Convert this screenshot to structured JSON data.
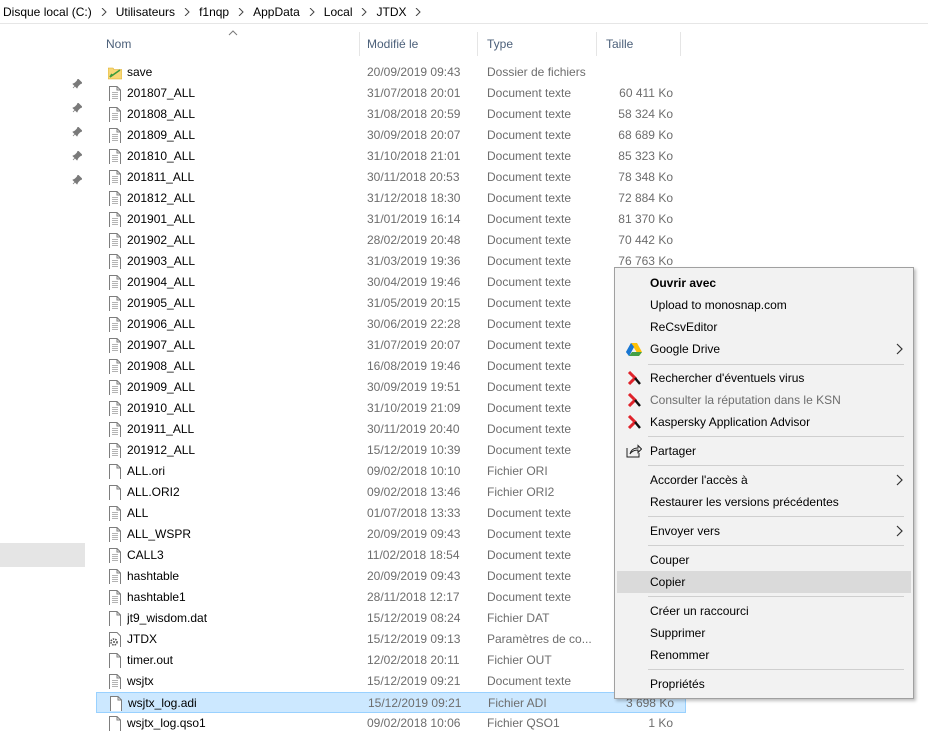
{
  "breadcrumb": [
    "Disque local (C:)",
    "Utilisateurs",
    "f1nqp",
    "AppData",
    "Local",
    "JTDX"
  ],
  "columns": {
    "name": "Nom",
    "modified": "Modifié le",
    "type": "Type",
    "size": "Taille"
  },
  "files": [
    {
      "name": "save",
      "date": "20/09/2019 09:43",
      "type": "Dossier de fichiers",
      "size": "",
      "icon": "folder-icon"
    },
    {
      "name": "201807_ALL",
      "date": "31/07/2018 20:01",
      "type": "Document texte",
      "size": "60 411 Ko",
      "icon": "text-file-icon"
    },
    {
      "name": "201808_ALL",
      "date": "31/08/2018 20:59",
      "type": "Document texte",
      "size": "58 324 Ko",
      "icon": "text-file-icon"
    },
    {
      "name": "201809_ALL",
      "date": "30/09/2018 20:07",
      "type": "Document texte",
      "size": "68 689 Ko",
      "icon": "text-file-icon"
    },
    {
      "name": "201810_ALL",
      "date": "31/10/2018 21:01",
      "type": "Document texte",
      "size": "85 323 Ko",
      "icon": "text-file-icon"
    },
    {
      "name": "201811_ALL",
      "date": "30/11/2018 20:53",
      "type": "Document texte",
      "size": "78 348 Ko",
      "icon": "text-file-icon"
    },
    {
      "name": "201812_ALL",
      "date": "31/12/2018 18:30",
      "type": "Document texte",
      "size": "72 884 Ko",
      "icon": "text-file-icon"
    },
    {
      "name": "201901_ALL",
      "date": "31/01/2019 16:14",
      "type": "Document texte",
      "size": "81 370 Ko",
      "icon": "text-file-icon"
    },
    {
      "name": "201902_ALL",
      "date": "28/02/2019 20:48",
      "type": "Document texte",
      "size": "70 442 Ko",
      "icon": "text-file-icon"
    },
    {
      "name": "201903_ALL",
      "date": "31/03/2019 19:36",
      "type": "Document texte",
      "size": "76 763 Ko",
      "icon": "text-file-icon"
    },
    {
      "name": "201904_ALL",
      "date": "30/04/2019 19:46",
      "type": "Document texte",
      "size": "",
      "icon": "text-file-icon"
    },
    {
      "name": "201905_ALL",
      "date": "31/05/2019 20:15",
      "type": "Document texte",
      "size": "",
      "icon": "text-file-icon"
    },
    {
      "name": "201906_ALL",
      "date": "30/06/2019 22:28",
      "type": "Document texte",
      "size": "",
      "icon": "text-file-icon"
    },
    {
      "name": "201907_ALL",
      "date": "31/07/2019 20:07",
      "type": "Document texte",
      "size": "",
      "icon": "text-file-icon"
    },
    {
      "name": "201908_ALL",
      "date": "16/08/2019 19:46",
      "type": "Document texte",
      "size": "",
      "icon": "text-file-icon"
    },
    {
      "name": "201909_ALL",
      "date": "30/09/2019 19:51",
      "type": "Document texte",
      "size": "",
      "icon": "text-file-icon"
    },
    {
      "name": "201910_ALL",
      "date": "31/10/2019 21:09",
      "type": "Document texte",
      "size": "",
      "icon": "text-file-icon"
    },
    {
      "name": "201911_ALL",
      "date": "30/11/2019 20:40",
      "type": "Document texte",
      "size": "",
      "icon": "text-file-icon"
    },
    {
      "name": "201912_ALL",
      "date": "15/12/2019 10:39",
      "type": "Document texte",
      "size": "",
      "icon": "text-file-icon"
    },
    {
      "name": "ALL.ori",
      "date": "09/02/2018 10:10",
      "type": "Fichier ORI",
      "size": "",
      "icon": "file-icon"
    },
    {
      "name": "ALL.ORI2",
      "date": "09/02/2018 13:46",
      "type": "Fichier ORI2",
      "size": "",
      "icon": "file-icon"
    },
    {
      "name": "ALL",
      "date": "01/07/2018 13:33",
      "type": "Document texte",
      "size": "",
      "icon": "text-file-icon"
    },
    {
      "name": "ALL_WSPR",
      "date": "20/09/2019 09:43",
      "type": "Document texte",
      "size": "",
      "icon": "text-file-icon"
    },
    {
      "name": "CALL3",
      "date": "11/02/2018 18:54",
      "type": "Document texte",
      "size": "",
      "icon": "text-file-icon"
    },
    {
      "name": "hashtable",
      "date": "20/09/2019 09:43",
      "type": "Document texte",
      "size": "",
      "icon": "text-file-icon"
    },
    {
      "name": "hashtable1",
      "date": "28/11/2018 12:17",
      "type": "Document texte",
      "size": "",
      "icon": "text-file-icon"
    },
    {
      "name": "jt9_wisdom.dat",
      "date": "15/12/2019 08:24",
      "type": "Fichier DAT",
      "size": "",
      "icon": "file-icon"
    },
    {
      "name": "JTDX",
      "date": "15/12/2019 09:13",
      "type": "Paramètres de co...",
      "size": "",
      "icon": "settings-file-icon"
    },
    {
      "name": "timer.out",
      "date": "12/02/2018 20:11",
      "type": "Fichier OUT",
      "size": "",
      "icon": "file-icon"
    },
    {
      "name": "wsjtx",
      "date": "15/12/2019 09:21",
      "type": "Document texte",
      "size": "",
      "icon": "text-file-icon"
    },
    {
      "name": "wsjtx_log.adi",
      "date": "15/12/2019 09:21",
      "type": "Fichier ADI",
      "size": "3 698 Ko",
      "icon": "file-icon",
      "selected": true
    },
    {
      "name": "wsjtx_log.qso1",
      "date": "09/02/2018 10:06",
      "type": "Fichier QSO1",
      "size": "1 Ko",
      "icon": "file-icon"
    }
  ],
  "context_menu": {
    "open_with": "Ouvrir avec",
    "upload_monosnap": "Upload to monosnap.com",
    "recsveditor": "ReCsvEditor",
    "google_drive": "Google Drive",
    "scan_viruses": "Rechercher d'éventuels virus",
    "ksn_reputation": "Consulter la réputation dans le KSN",
    "kaspersky_advisor": "Kaspersky Application Advisor",
    "share": "Partager",
    "give_access": "Accorder l'accès à",
    "restore_versions": "Restaurer les versions précédentes",
    "send_to": "Envoyer vers",
    "cut": "Couper",
    "copy": "Copier",
    "create_shortcut": "Créer un raccourci",
    "delete": "Supprimer",
    "rename": "Renommer",
    "properties": "Propriétés"
  },
  "colors": {
    "selection": "#cce8ff",
    "selection_border": "#99d1ff",
    "menu_bg": "#f2f2f2",
    "menu_hover": "#dadada",
    "kaspersky_red": "#e0232b"
  }
}
